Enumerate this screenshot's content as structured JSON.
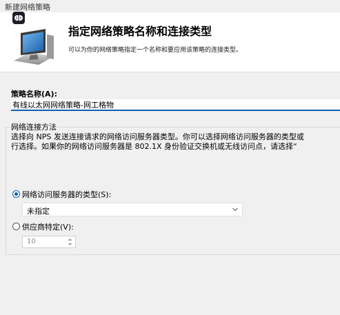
{
  "window": {
    "title": "新建网络策略"
  },
  "header": {
    "title": "指定网络策略名称和连接类型",
    "subtitle": "可以为你的网络策略指定一个名称和要应用该策略的连接类型。"
  },
  "policy_name": {
    "label": "策略名称(A):",
    "value": "有线以太网网络策略-网工格物"
  },
  "connection_method": {
    "group_label": "网络连接方法",
    "description_line1": "选择向 NPS 发送连接请求的网络访问服务器类型。你可以选择网络访问服务器的类型或",
    "description_line2": "行选择。如果你的网络访问服务器是 802.1X 身份验证交换机或无线访问点，请选择“"
  },
  "server_type": {
    "label": "网络访问服务器的类型(S):",
    "selected": true,
    "dropdown_value": "未指定"
  },
  "vendor_specific": {
    "label": "供应商特定(V):",
    "selected": false,
    "value": "10"
  },
  "colors": {
    "accent": "#0a5fb4",
    "window_bg": "#f0f0f0",
    "header_bg": "#ffffff"
  },
  "icons": {
    "app": "brain-icon",
    "header": "network-computer-icon",
    "dropdown": "chevron-down-icon",
    "spin_up": "spin-up-icon",
    "spin_down": "spin-down-icon"
  }
}
